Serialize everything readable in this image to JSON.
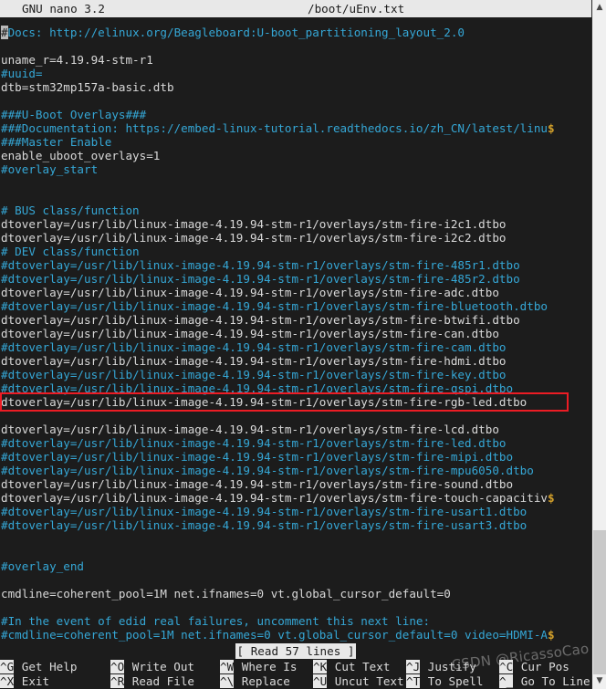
{
  "titlebar": {
    "app": "GNU nano 3.2",
    "filename": "/boot/uEnv.txt"
  },
  "editor": {
    "cursor_char": "#",
    "lines": [
      {
        "type": "comment",
        "text": "#Docs: http://elinux.org/Beagleboard:U-boot_partitioning_layout_2.0",
        "cursor_first": true
      },
      {
        "type": "blank",
        "text": ""
      },
      {
        "type": "text",
        "text": "uname_r=4.19.94-stm-r1"
      },
      {
        "type": "comment",
        "text": "#uuid="
      },
      {
        "type": "text",
        "text": "dtb=stm32mp157a-basic.dtb"
      },
      {
        "type": "blank",
        "text": ""
      },
      {
        "type": "comment",
        "text": "###U-Boot Overlays###"
      },
      {
        "type": "comment",
        "text": "###Documentation: https://embed-linux-tutorial.readthedocs.io/zh_CN/latest/linu",
        "continued": true
      },
      {
        "type": "comment",
        "text": "###Master Enable"
      },
      {
        "type": "text",
        "text": "enable_uboot_overlays=1"
      },
      {
        "type": "comment",
        "text": "#overlay_start"
      },
      {
        "type": "blank",
        "text": ""
      },
      {
        "type": "blank",
        "text": ""
      },
      {
        "type": "comment",
        "text": "# BUS class/function"
      },
      {
        "type": "text",
        "text": "dtoverlay=/usr/lib/linux-image-4.19.94-stm-r1/overlays/stm-fire-i2c1.dtbo"
      },
      {
        "type": "text",
        "text": "dtoverlay=/usr/lib/linux-image-4.19.94-stm-r1/overlays/stm-fire-i2c2.dtbo"
      },
      {
        "type": "comment",
        "text": "# DEV class/function"
      },
      {
        "type": "comment",
        "text": "#dtoverlay=/usr/lib/linux-image-4.19.94-stm-r1/overlays/stm-fire-485r1.dtbo"
      },
      {
        "type": "comment",
        "text": "#dtoverlay=/usr/lib/linux-image-4.19.94-stm-r1/overlays/stm-fire-485r2.dtbo"
      },
      {
        "type": "text",
        "text": "dtoverlay=/usr/lib/linux-image-4.19.94-stm-r1/overlays/stm-fire-adc.dtbo"
      },
      {
        "type": "comment",
        "text": "#dtoverlay=/usr/lib/linux-image-4.19.94-stm-r1/overlays/stm-fire-bluetooth.dtbo"
      },
      {
        "type": "text",
        "text": "dtoverlay=/usr/lib/linux-image-4.19.94-stm-r1/overlays/stm-fire-btwifi.dtbo"
      },
      {
        "type": "text",
        "text": "dtoverlay=/usr/lib/linux-image-4.19.94-stm-r1/overlays/stm-fire-can.dtbo"
      },
      {
        "type": "comment",
        "text": "#dtoverlay=/usr/lib/linux-image-4.19.94-stm-r1/overlays/stm-fire-cam.dtbo"
      },
      {
        "type": "text",
        "text": "dtoverlay=/usr/lib/linux-image-4.19.94-stm-r1/overlays/stm-fire-hdmi.dtbo"
      },
      {
        "type": "comment",
        "text": "#dtoverlay=/usr/lib/linux-image-4.19.94-stm-r1/overlays/stm-fire-key.dtbo"
      },
      {
        "type": "comment",
        "text": "#dtoverlay=/usr/lib/linux-image-4.19.94-stm-r1/overlays/stm-fire-qspi.dtbo"
      },
      {
        "type": "text",
        "text": "dtoverlay=/usr/lib/linux-image-4.19.94-stm-r1/overlays/stm-fire-rgb-led.dtbo",
        "highlighted": true
      },
      {
        "type": "blank",
        "text": ""
      },
      {
        "type": "text",
        "text": "dtoverlay=/usr/lib/linux-image-4.19.94-stm-r1/overlays/stm-fire-lcd.dtbo"
      },
      {
        "type": "comment",
        "text": "#dtoverlay=/usr/lib/linux-image-4.19.94-stm-r1/overlays/stm-fire-led.dtbo"
      },
      {
        "type": "comment",
        "text": "#dtoverlay=/usr/lib/linux-image-4.19.94-stm-r1/overlays/stm-fire-mipi.dtbo"
      },
      {
        "type": "comment",
        "text": "#dtoverlay=/usr/lib/linux-image-4.19.94-stm-r1/overlays/stm-fire-mpu6050.dtbo"
      },
      {
        "type": "text",
        "text": "dtoverlay=/usr/lib/linux-image-4.19.94-stm-r1/overlays/stm-fire-sound.dtbo"
      },
      {
        "type": "text",
        "text": "dtoverlay=/usr/lib/linux-image-4.19.94-stm-r1/overlays/stm-fire-touch-capacitiv",
        "continued": true
      },
      {
        "type": "comment",
        "text": "#dtoverlay=/usr/lib/linux-image-4.19.94-stm-r1/overlays/stm-fire-usart1.dtbo"
      },
      {
        "type": "comment",
        "text": "#dtoverlay=/usr/lib/linux-image-4.19.94-stm-r1/overlays/stm-fire-usart3.dtbo"
      },
      {
        "type": "blank",
        "text": ""
      },
      {
        "type": "blank",
        "text": ""
      },
      {
        "type": "comment",
        "text": "#overlay_end"
      },
      {
        "type": "blank",
        "text": ""
      },
      {
        "type": "text",
        "text": "cmdline=coherent_pool=1M net.ifnames=0 vt.global_cursor_default=0"
      },
      {
        "type": "blank",
        "text": ""
      },
      {
        "type": "comment",
        "text": "#In the event of edid real failures, uncomment this next line:"
      },
      {
        "type": "comment",
        "text": "#cmdline=coherent_pool=1M net.ifnames=0 vt.global_cursor_default=0 video=HDMI-A",
        "continued": true
      }
    ]
  },
  "status": {
    "message": "[ Read 57 lines ]"
  },
  "helpbar": {
    "row1": [
      {
        "key": "^G",
        "label": "Get Help"
      },
      {
        "key": "^O",
        "label": "Write Out"
      },
      {
        "key": "^W",
        "label": "Where Is"
      },
      {
        "key": "^K",
        "label": "Cut Text"
      },
      {
        "key": "^J",
        "label": "Justify"
      },
      {
        "key": "^C",
        "label": "Cur Pos"
      }
    ],
    "row2": [
      {
        "key": "^X",
        "label": "Exit"
      },
      {
        "key": "^R",
        "label": "Read File"
      },
      {
        "key": "^\\",
        "label": "Replace"
      },
      {
        "key": "^U",
        "label": "Uncut Text"
      },
      {
        "key": "^T",
        "label": "To Spell"
      },
      {
        "key": "^_",
        "label": "Go To Line"
      }
    ]
  },
  "watermark": {
    "text": "CSDN @RicassoCao"
  },
  "scrollbar": {
    "up_arrow": "▲",
    "down_arrow": "▼"
  },
  "colors": {
    "background": "#1c1c1c",
    "comment": "#35a7d6",
    "text": "#d9d9d9",
    "inverse_bg": "#e8e8e8",
    "inverse_fg": "#1b1b1b",
    "annotation": "#ec1c24",
    "continuation": "#d3a02a"
  }
}
